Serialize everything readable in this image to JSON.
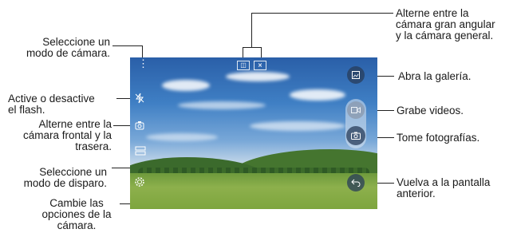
{
  "labels": {
    "mode": "Seleccione un\nmodo de cámara.",
    "flash": "Active o desactive\nel flash.",
    "switch_camera": "Alterne entre la\ncámara frontal y la\ntrasera.",
    "shooting_mode": "Seleccione un\nmodo de disparo.",
    "settings": "Cambie las\nopciones de la\ncámara.",
    "wide_angle": "Alterne entre la\ncámara gran angular\ny la cámara general.",
    "gallery": "Abra la galería.",
    "video": "Grabe videos.",
    "photo": "Tome fotografías.",
    "back": "Vuelva a la pantalla\nanterior."
  },
  "icons": {
    "more": "more-vertical-icon",
    "flash": "flash-off-icon",
    "switch": "switch-camera-icon",
    "mode": "shooting-mode-icon",
    "settings": "settings-gear-icon",
    "lens_wide": "wide-lens-icon",
    "lens_general": "general-lens-icon",
    "gallery": "gallery-icon",
    "video": "video-camera-icon",
    "photo": "camera-icon",
    "back": "back-arrow-icon"
  }
}
